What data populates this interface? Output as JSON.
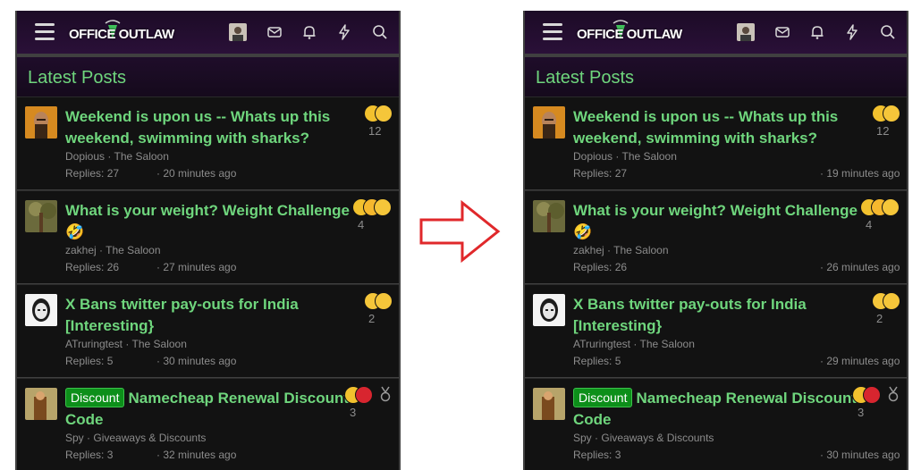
{
  "brand": {
    "logo_text": "OFFICE OUTLAW"
  },
  "section_title": "Latest Posts",
  "colors": {
    "accent_green": "#6fd67d",
    "header_purple": "#2a1038",
    "badge_green": "#0d8f1a",
    "arrow_red": "#e0282b"
  },
  "header_icons": [
    "menu-icon",
    "user-avatar",
    "mail-icon",
    "bell-icon",
    "bolt-icon",
    "search-icon"
  ],
  "left": {
    "posts": [
      {
        "title": "Weekend is upon us -- Whats up this weekend, swimming with sharks?",
        "author": "Dopious",
        "forum": "The Saloon",
        "replies": "Replies: 27",
        "time": "20 minutes ago",
        "reactions": "12"
      },
      {
        "title": "What is your weight? Weight Challenge 🤣",
        "author": "zakhej",
        "forum": "The Saloon",
        "replies": "Replies: 26",
        "time": "27 minutes ago",
        "reactions": "4"
      },
      {
        "title": "X Bans twitter pay-outs for India [Interesting}",
        "author": "ATruringtest",
        "forum": "The Saloon",
        "replies": "Replies: 5",
        "time": "30 minutes ago",
        "reactions": "2"
      },
      {
        "badge": "Discount",
        "title": "Namecheap Renewal Discount Code",
        "author": "Spy",
        "forum": "Giveaways & Discounts",
        "replies": "Replies: 3",
        "time": "32 minutes ago",
        "reactions": "3"
      }
    ]
  },
  "right": {
    "posts": [
      {
        "title": "Weekend is upon us -- Whats up this weekend, swimming with sharks?",
        "author": "Dopious",
        "forum": "The Saloon",
        "replies": "Replies: 27",
        "time": "19 minutes ago",
        "reactions": "12"
      },
      {
        "title": "What is your weight? Weight Challenge 🤣",
        "author": "zakhej",
        "forum": "The Saloon",
        "replies": "Replies: 26",
        "time": "26 minutes ago",
        "reactions": "4"
      },
      {
        "title": "X Bans twitter pay-outs for India [Interesting}",
        "author": "ATruringtest",
        "forum": "The Saloon",
        "replies": "Replies: 5",
        "time": "29 minutes ago",
        "reactions": "2"
      },
      {
        "badge": "Discount",
        "title": "Namecheap Renewal Discount Code",
        "author": "Spy",
        "forum": "Giveaways & Discounts",
        "replies": "Replies: 3",
        "time": "30 minutes ago",
        "reactions": "3"
      }
    ]
  }
}
